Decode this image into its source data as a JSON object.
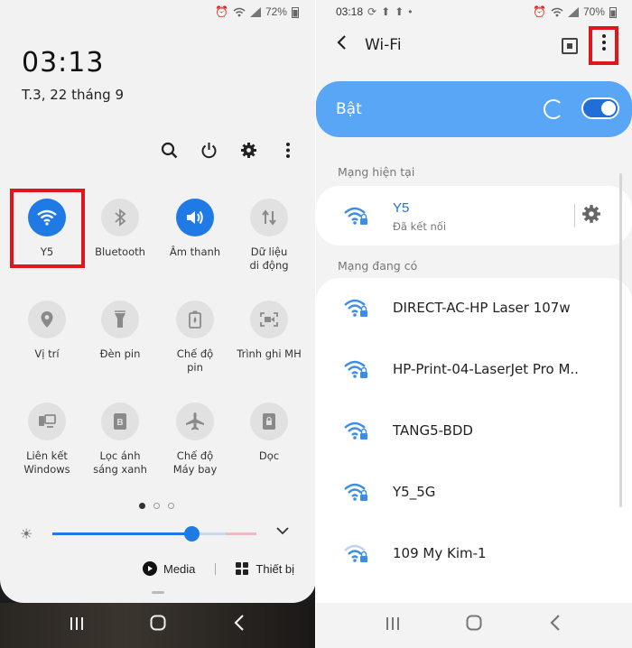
{
  "left": {
    "status": {
      "alarm": "⏰",
      "signal": "▮",
      "battery": "72%"
    },
    "clock": "03:13",
    "date": "T.3, 22 tháng 9",
    "tiles": [
      {
        "label": "Y5",
        "active": true
      },
      {
        "label": "Bluetooth",
        "active": false
      },
      {
        "label": "Âm thanh",
        "active": true
      },
      {
        "label": "Dữ liệu\ndi động",
        "active": false
      },
      {
        "label": "Vị trí",
        "active": false
      },
      {
        "label": "Đèn pin",
        "active": false
      },
      {
        "label": "Chế độ\npin",
        "active": false
      },
      {
        "label": "Trình ghi MH",
        "active": false
      },
      {
        "label": "Liên kết\nWindows",
        "active": false
      },
      {
        "label": "Lọc ánh\nsáng xanh",
        "active": false
      },
      {
        "label": "Chế độ\nMáy bay",
        "active": false
      },
      {
        "label": "Dọc",
        "active": false
      }
    ],
    "brightness": 0.68,
    "media_label": "Media",
    "devices_label": "Thiết bị"
  },
  "right": {
    "status": {
      "time": "03:18",
      "battery": "70%"
    },
    "title": "Wi-Fi",
    "toggle_label": "Bật",
    "current_header": "Mạng hiện tại",
    "current_network": {
      "name": "Y5",
      "status": "Đã kết nối"
    },
    "available_header": "Mạng đang có",
    "networks": [
      {
        "name": "DIRECT-AC-HP Laser 107w"
      },
      {
        "name": "HP-Print-04-LaserJet Pro M.."
      },
      {
        "name": "TANG5-BDD"
      },
      {
        "name": "Y5_5G"
      },
      {
        "name": "109 My Kim-1"
      }
    ]
  },
  "colors": {
    "accent": "#1f7ae6",
    "highlight": "#e0161d",
    "toggle_bg": "#58a6f5"
  }
}
